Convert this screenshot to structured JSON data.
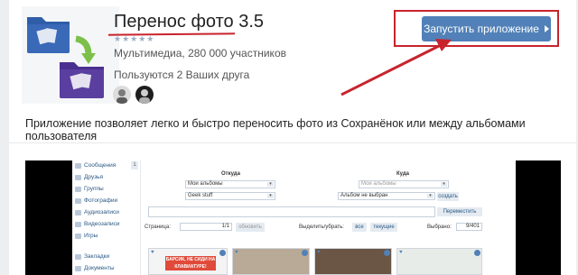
{
  "app": {
    "title": "Перенос фото 3.5",
    "rating_stars": "★★★★★",
    "category_line": "Мультимедиа, 280 000 участников",
    "friends_line": "Пользуются 2 Ваших друга",
    "launch_button": "Запустить приложение",
    "description": "Приложение позволяет легко и быстро переносить фото из Сохранёнок или между альбомами пользователя"
  },
  "colors": {
    "accent": "#5181b8",
    "highlight_red": "#c8232c",
    "folder_blue": "#3a69b8",
    "folder_purple": "#5a3fa0",
    "arrow_green": "#7cc04a"
  },
  "preview": {
    "sidebar": {
      "items": [
        {
          "label": "Сообщения",
          "icon": "message-icon"
        },
        {
          "label": "Друзья",
          "icon": "friends-icon"
        },
        {
          "label": "Группы",
          "icon": "groups-icon"
        },
        {
          "label": "Фотографии",
          "icon": "photos-icon"
        },
        {
          "label": "Аудиозаписи",
          "icon": "audio-icon"
        },
        {
          "label": "Видеозаписи",
          "icon": "video-icon"
        },
        {
          "label": "Игры",
          "icon": "games-icon"
        }
      ],
      "items_bottom": [
        {
          "label": "Закладки",
          "icon": "bookmarks-icon"
        },
        {
          "label": "Документы",
          "icon": "documents-icon"
        }
      ],
      "badge": "1"
    },
    "from_label": "Откуда",
    "to_label": "Куда",
    "from_owner": "Мои альбомы",
    "to_owner": "Мои альбомы",
    "from_album": "Geek stuff",
    "to_album": "Альбом не выбран",
    "create_button": "создать",
    "move_button": "Переместить",
    "page_label": "Страница:",
    "page_value": "1/1",
    "refresh_button": "обновить",
    "select_label": "Выделить/убрать:",
    "all_button": "все",
    "current_button": "текущие",
    "selected_label": "Выбрано:",
    "selected_value": "9/401",
    "thumb_caption": "БАРСИК, НЕ СИДИ НА КЛАВИАТУРЕ!"
  }
}
